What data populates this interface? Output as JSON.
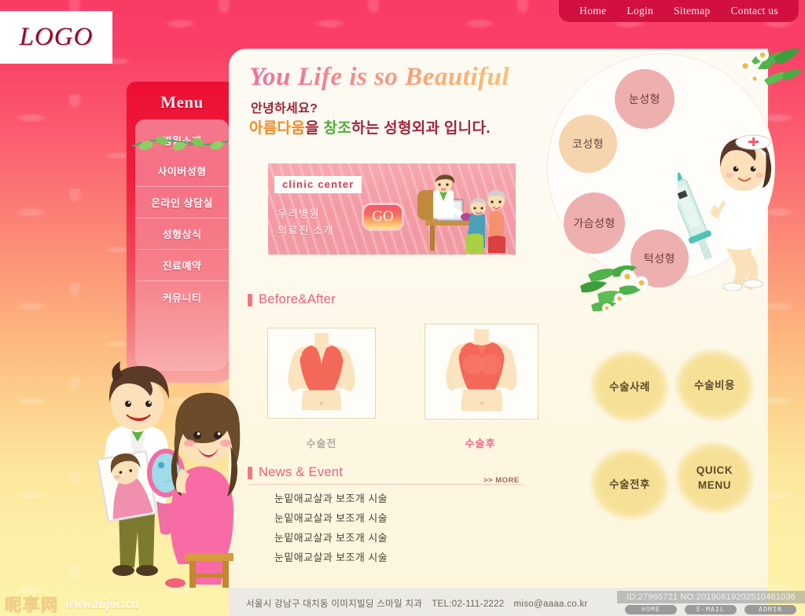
{
  "topnav": {
    "items": [
      {
        "label": "Home",
        "name": "nav-home"
      },
      {
        "label": "Login",
        "name": "nav-login"
      },
      {
        "label": "Sitemap",
        "name": "nav-sitemap"
      },
      {
        "label": "Contact us",
        "name": "nav-contact-us"
      }
    ]
  },
  "logo": {
    "text": "LOGO"
  },
  "menu": {
    "title": "Menu",
    "items": [
      "병원소개",
      "사이버성형",
      "온라인 상담실",
      "성형상식",
      "진료예약",
      "커뮤니티"
    ]
  },
  "hero": {
    "headline": "You  Life is so Beautiful",
    "greeting": "안녕하세요?",
    "tagline_part1": "아름다움",
    "tagline_part2": "을 ",
    "tagline_part3": "창조",
    "tagline_part4": "하는 성형외과 입니다."
  },
  "clinic_banner": {
    "tag": "clinic center",
    "line1": "우리병원",
    "line2": "의료진 소개",
    "go_label": "GO"
  },
  "before_after": {
    "title": "Before&After",
    "caption_before": "수술전",
    "caption_after": "수술후"
  },
  "news": {
    "title": "News & Event",
    "more_label": ">> MORE",
    "items": [
      "눈밑애교살과 보조개 시술",
      "눈밑애교살과 보조개 시술",
      "눈밑애교살과 보조개 시술",
      "눈밑애교살과 보조개 시술"
    ]
  },
  "bubbles": [
    {
      "label": "눈성형",
      "color": "#eeafaf"
    },
    {
      "label": "코성형",
      "color": "#f6d5ae"
    },
    {
      "label": "가슴성형",
      "color": "#eeafaf"
    },
    {
      "label": "턱성형",
      "color": "#eeafaf"
    }
  ],
  "quick_menu": [
    {
      "label": "수술사례"
    },
    {
      "label": "수술비용"
    },
    {
      "label": "수술전후"
    },
    {
      "label": "QUICK MENU",
      "line1": "QUICK",
      "line2": "MENU"
    }
  ],
  "footer": {
    "address": "서울시 강남구 대치동 이미지빌딩 스마일 치과",
    "tel": "TEL:02-111-2222",
    "email": "miso@aaaa.co.kr"
  },
  "watermark": {
    "id_line": "ID:27965721 NO:20190819202510481036",
    "buttons": [
      "HOME",
      "E-MAIL",
      "ADMIN"
    ],
    "site_cn": "昵享网",
    "site_url": "www.nipic.cn"
  },
  "colors": {
    "brand_red": "#ec0f34",
    "nav_bar": "#d2103f",
    "accent_pink": "#ef5f7d",
    "bubble_pink": "#eeafaf",
    "bubble_peach": "#f6d5ae",
    "splat_yellow": "#f8e39b",
    "content_bg": "#fdfaf2"
  }
}
